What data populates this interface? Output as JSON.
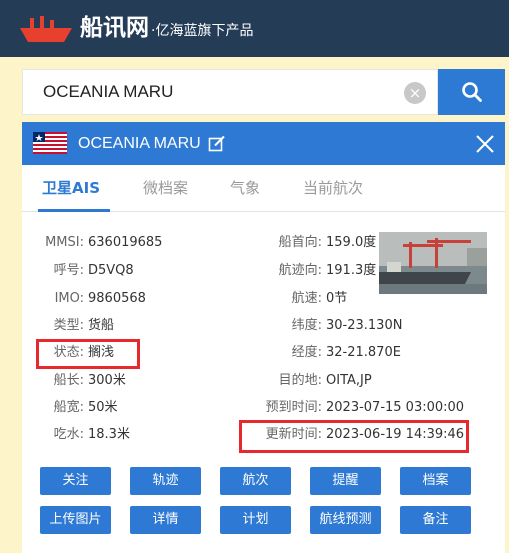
{
  "header": {
    "logo_text": "船讯网",
    "logo_sub": "·亿海蓝旗下产品"
  },
  "search": {
    "value": "OCEANIA MARU",
    "clear_glyph": "×"
  },
  "panel": {
    "ship_name": "OCEANIA MARU",
    "close_glyph": "✕",
    "tabs": [
      {
        "label": "卫星AIS"
      },
      {
        "label": "微档案"
      },
      {
        "label": "气象"
      },
      {
        "label": "当前航次"
      }
    ],
    "left_fields": [
      {
        "label": "MMSI:",
        "value": "636019685"
      },
      {
        "label": "呼号:",
        "value": "D5VQ8"
      },
      {
        "label": "IMO:",
        "value": "9860568"
      },
      {
        "label": "类型:",
        "value": "货船"
      },
      {
        "label": "状态:",
        "value": "搁浅"
      },
      {
        "label": "船长:",
        "value": "300米"
      },
      {
        "label": "船宽:",
        "value": "50米"
      },
      {
        "label": "吃水:",
        "value": "18.3米"
      }
    ],
    "right_fields": [
      {
        "label": "船首向:",
        "value": "159.0度"
      },
      {
        "label": "航迹向:",
        "value": "191.3度"
      },
      {
        "label": "航速:",
        "value": "0节"
      },
      {
        "label": "纬度:",
        "value": "30-23.130N"
      },
      {
        "label": "经度:",
        "value": "32-21.870E"
      },
      {
        "label": "目的地:",
        "value": "OITA,JP"
      },
      {
        "label": "预到时间:",
        "value": "2023-07-15 03:00:00"
      },
      {
        "label": "更新时间:",
        "value": "2023-06-19 14:39:46"
      }
    ],
    "buttons_row1": [
      {
        "label": "关注"
      },
      {
        "label": "轨迹"
      },
      {
        "label": "航次"
      },
      {
        "label": "提醒"
      },
      {
        "label": "档案"
      }
    ],
    "buttons_row2": [
      {
        "label": "上传图片"
      },
      {
        "label": "详情"
      },
      {
        "label": "计划"
      },
      {
        "label": "航线预测"
      },
      {
        "label": "备注"
      }
    ]
  },
  "colors": {
    "header_bg": "#243c56",
    "accent": "#2e79d3",
    "highlight": "#e7282f",
    "page_bg": "#fdf5c9"
  }
}
